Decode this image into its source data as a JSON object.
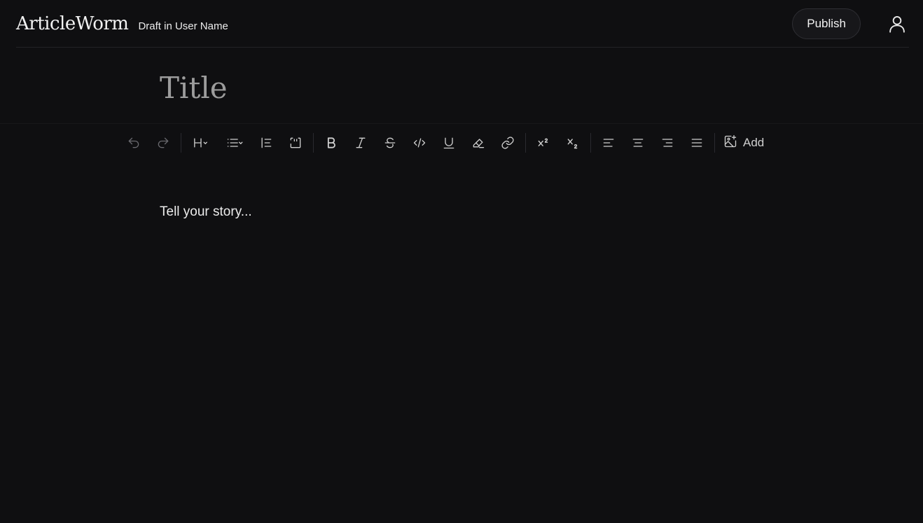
{
  "header": {
    "logo": "ArticleWorm",
    "draft_text": "Draft in User Name",
    "publish_label": "Publish",
    "profile_icon": "user-icon"
  },
  "editor": {
    "title_placeholder": "Title",
    "body_placeholder": "Tell your story..."
  },
  "toolbar": {
    "add_label": "Add",
    "groups": [
      [
        "undo-icon",
        "redo-icon"
      ],
      [
        "heading-icon",
        "list-icon",
        "blockquote-icon",
        "code-block-icon"
      ],
      [
        "bold-icon",
        "italic-icon",
        "strikethrough-icon",
        "code-icon",
        "underline-icon",
        "highlight-icon",
        "link-icon"
      ],
      [
        "superscript-icon",
        "subscript-icon"
      ],
      [
        "align-left-icon",
        "align-center-icon",
        "align-right-icon",
        "align-justify-icon"
      ],
      [
        "add-image-icon"
      ]
    ]
  },
  "colors": {
    "background": "#0f0f11",
    "text": "#e8e8e8",
    "muted": "#9a9a9a"
  }
}
